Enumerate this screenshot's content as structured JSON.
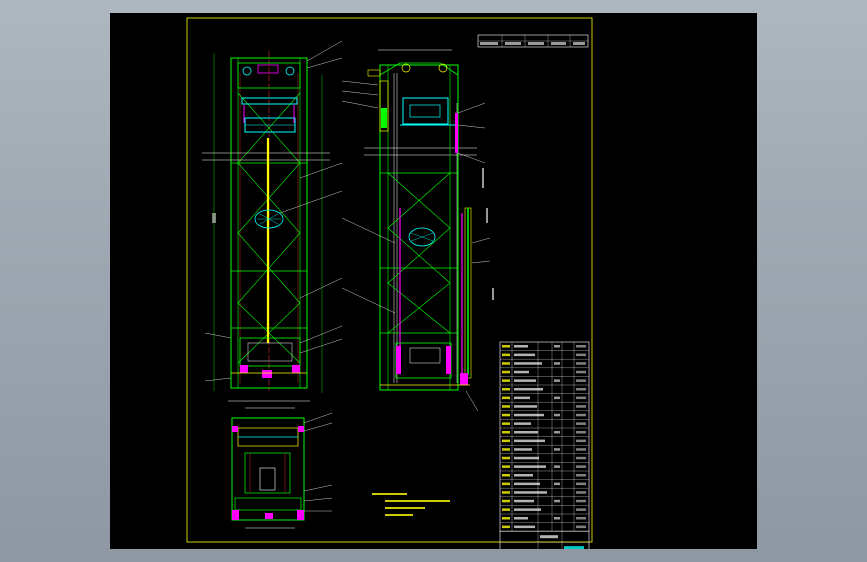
{
  "app": {
    "background_color": "#9aa3ad",
    "canvas_color": "#000000"
  },
  "colors": {
    "frame": "#ffff00",
    "structure": "#00ff00",
    "cabin": "#00ffff",
    "counterweight": "#ff00ff",
    "centerline": "#ff3333",
    "annotation": "#ffffff"
  },
  "icons": {
    "title_block": "table",
    "parts_list": "table",
    "section_marker": "circle-hatched"
  },
  "drawing": {
    "views": [
      {
        "name": "front-elevation"
      },
      {
        "name": "side-elevation"
      },
      {
        "name": "plan-view"
      }
    ]
  }
}
